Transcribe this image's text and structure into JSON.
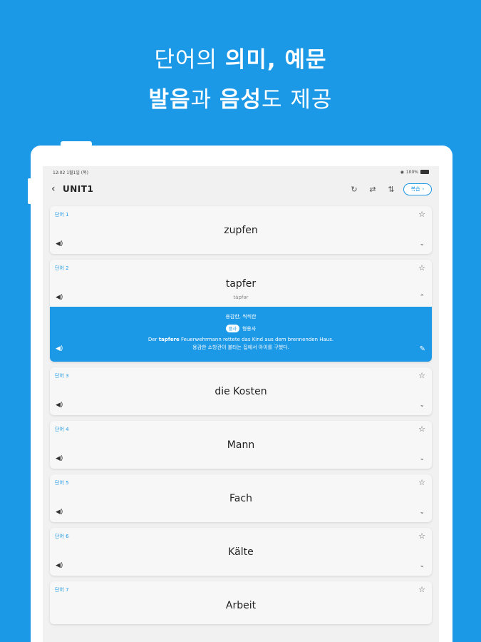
{
  "headline": {
    "line1_a": "단어의 ",
    "line1_b": "의미, 예문",
    "line2_a": "발음",
    "line2_b": "과 ",
    "line2_c": "음성",
    "line2_d": "도 제공"
  },
  "status": {
    "time": "12:02",
    "date": "1월1일 (목)",
    "wifi": "100%"
  },
  "nav": {
    "title": "UNIT1",
    "review_label": "복습"
  },
  "colors": {
    "accent": "#1b98e6"
  },
  "cards": [
    {
      "label": "단어 1",
      "word": "zupfen"
    },
    {
      "label": "단어 2",
      "word": "tapfer",
      "pron": "tápfər",
      "meaning": "용감한, 씩씩한",
      "pos": "품사",
      "pos_value": "형용사",
      "example_pre": "Der ",
      "example_hl": "tapfere",
      "example_post": " Feuerwehrmann rettete das Kind aus dem brennenden Haus.",
      "example_ko": "용감한 소방관이 불타는 집에서 아이를 구했다."
    },
    {
      "label": "단어 3",
      "word": "die Kosten"
    },
    {
      "label": "단어 4",
      "word": "Mann"
    },
    {
      "label": "단어 5",
      "word": "Fach"
    },
    {
      "label": "단어 6",
      "word": "Kälte"
    },
    {
      "label": "단어 7",
      "word": "Arbeit"
    }
  ]
}
